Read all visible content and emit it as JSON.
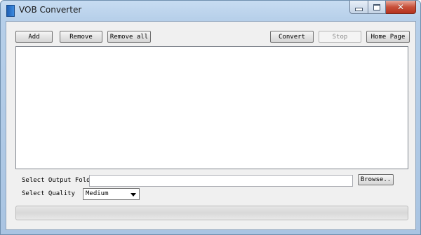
{
  "window": {
    "title": "VOB Converter"
  },
  "toolbar": {
    "add_label": "Add",
    "remove_label": "Remove",
    "remove_all_label": "Remove all",
    "convert_label": "Convert",
    "stop_label": "Stop",
    "home_page_label": "Home Page"
  },
  "file_list": {
    "items": []
  },
  "output": {
    "folder_label": "Select Output Folder",
    "folder_value": "",
    "browse_label": "Browse.."
  },
  "quality": {
    "label": "Select Quality",
    "selected": "Medium"
  },
  "progress": {
    "fraction": 0
  },
  "colors": {
    "accent": "#b9d3ee",
    "progress_fill": "#06b025",
    "close_button": "#c7503a"
  },
  "icons": [
    "app-icon",
    "minimize-icon",
    "maximize-icon",
    "close-icon",
    "dropdown-arrow-icon"
  ]
}
